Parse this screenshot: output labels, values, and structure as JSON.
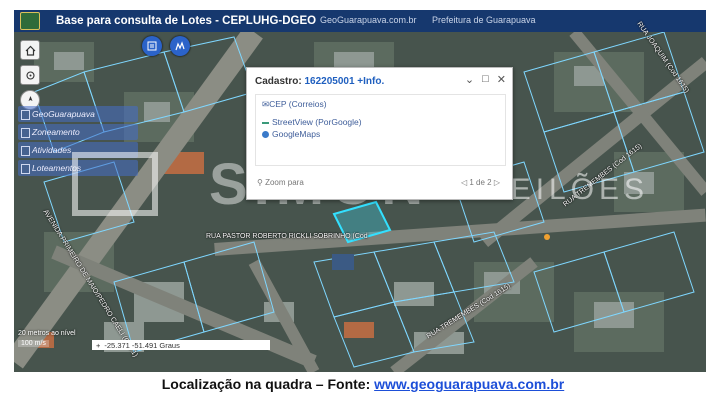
{
  "app": {
    "title": "Base para consulta de Lotes - CEPLUHG-DGEO",
    "links": [
      "GeoGuarapuava.com.br",
      "Prefeitura de Guarapuava"
    ]
  },
  "map_tools": {
    "home_icon": "home-icon",
    "locate_icon": "locate-icon",
    "compass_icon": "compass-icon",
    "list_button_icon": "list-icon",
    "chart_button_icon": "chart-icon"
  },
  "layers": [
    {
      "label": "GeoGuarapuava"
    },
    {
      "label": "Zoneamento"
    },
    {
      "label": "Atividades"
    },
    {
      "label": "Loteamentos"
    }
  ],
  "popup": {
    "label": "Cadastro:",
    "id": "162205001 +Info.",
    "links": [
      {
        "label": "CEP (Correios)",
        "icon": "mail-icon"
      },
      {
        "label": "StreetView (PorGoogle)",
        "icon": "streetview-icon"
      },
      {
        "label": "GoogleMaps",
        "icon": "globe-icon"
      }
    ],
    "zoom_label": "Zoom para",
    "pager": "1 de 2"
  },
  "streets": [
    "RUA PASTOR ROBERTO RICKLI SOBRINHO (Cod",
    "RUA TREMEMBES (Cod 1615)",
    "RUA TREMEMBES (Cod 1615)",
    "AVENIDA PRIMEIRO DE MAIO/PEDRO CAELI (Cod 1)",
    "RUA JOAQUIM (Cod 1615)"
  ],
  "watermark": {
    "brand": "SIMON",
    "sub": "LEILÕES"
  },
  "status": {
    "scale": "20 metros",
    "scale_hint": "ao nível",
    "unit": "100 m/s",
    "coords": "-25.371 -51.491 Graus"
  },
  "caption": {
    "text": "Localização na quadra – Fonte: ",
    "link": "www.geoguarapuava.com.br"
  },
  "colors": {
    "titlebar": "#16386e",
    "accent": "#2b63c9",
    "lot_outline": "#7fd7ff",
    "selected_lot": "#33e0ff"
  }
}
